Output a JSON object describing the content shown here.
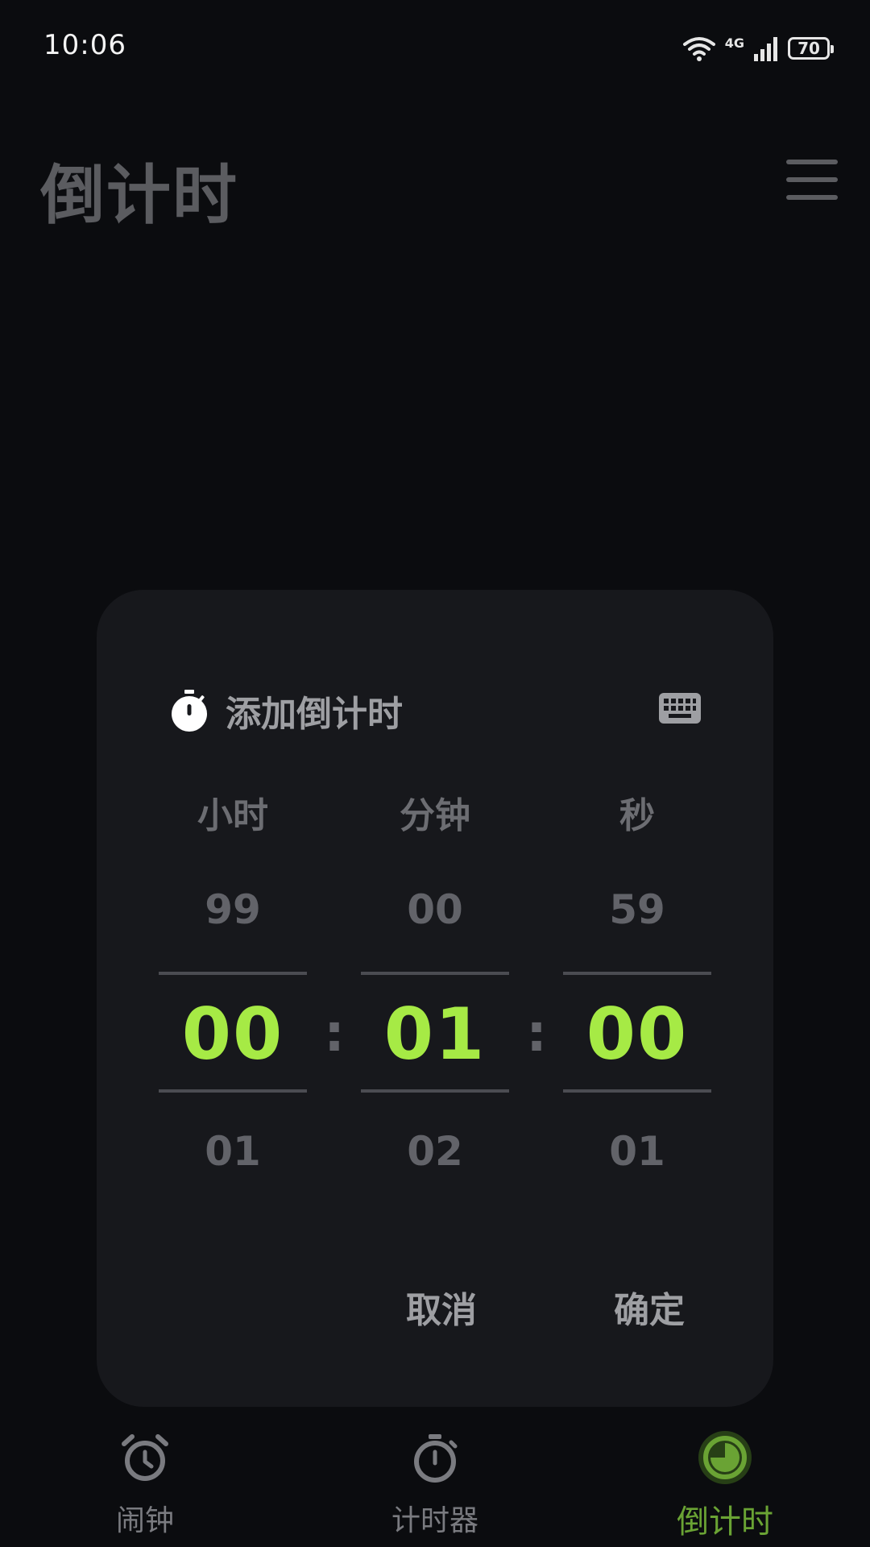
{
  "status_bar": {
    "time": "10:06",
    "network": "4G",
    "battery": "70"
  },
  "header": {
    "title": "倒计时"
  },
  "dialog": {
    "title": "添加倒计时",
    "columns": [
      {
        "label": "小时",
        "above": "99",
        "selected": "00",
        "below": "01"
      },
      {
        "label": "分钟",
        "above": "00",
        "selected": "01",
        "below": "02"
      },
      {
        "label": "秒",
        "above": "59",
        "selected": "00",
        "below": "01"
      }
    ],
    "separator": ":",
    "cancel_label": "取消",
    "confirm_label": "确定"
  },
  "nav": {
    "items": [
      {
        "label": "闹钟",
        "icon": "alarm-clock-icon"
      },
      {
        "label": "计时器",
        "icon": "stopwatch-icon"
      },
      {
        "label": "倒计时",
        "icon": "countdown-icon"
      }
    ],
    "active_color": "#6aa334"
  },
  "colors": {
    "accent": "#a6ea45",
    "dialog_bg": "#17181c",
    "page_bg": "#0b0c0f"
  }
}
